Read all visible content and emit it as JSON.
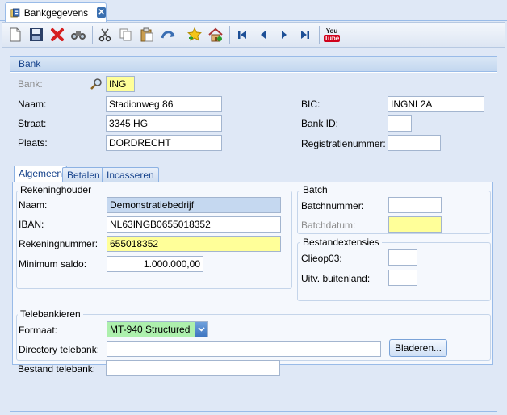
{
  "window": {
    "tab_title": "Bankgegevens",
    "colors": {
      "accent": "#15428b",
      "highlight": "#ffff99",
      "readonly": "#c5d8f0",
      "combo": "#adf0ad"
    }
  },
  "toolbar": {
    "icons": [
      "new-icon",
      "save-icon",
      "delete-icon",
      "find-icon",
      "cut-icon",
      "copy-icon",
      "paste-icon",
      "undo-icon",
      "favorite-icon",
      "home-icon",
      "first-record-icon",
      "previous-record-icon",
      "next-record-icon",
      "last-record-icon",
      "youtube-icon"
    ],
    "youtube_you": "You",
    "youtube_tube": "Tube"
  },
  "bank": {
    "header": "Bank",
    "labels": {
      "bank": "Bank:",
      "naam": "Naam:",
      "straat": "Straat:",
      "plaats": "Plaats:",
      "bic": "BIC:",
      "bank_id": "Bank ID:",
      "registratienummer": "Registratienummer:"
    },
    "values": {
      "bank": "ING",
      "naam": "Stadionweg 86",
      "straat": "3345 HG",
      "plaats": "DORDRECHT",
      "bic": "INGNL2A",
      "bank_id": "",
      "registratienummer": ""
    }
  },
  "tabs": [
    {
      "label": "Algemeen",
      "active": true
    },
    {
      "label": "Betalen",
      "active": false
    },
    {
      "label": "Incasseren",
      "active": false
    }
  ],
  "rekeninghouder": {
    "title": "Rekeninghouder",
    "labels": {
      "naam": "Naam:",
      "iban": "IBAN:",
      "rekeningnummer": "Rekeningnummer:",
      "minimum_saldo": "Minimum saldo:"
    },
    "values": {
      "naam": "Demonstratiebedrijf",
      "iban": "NL63INGB0655018352",
      "rekeningnummer": "655018352",
      "minimum_saldo": "1.000.000,00"
    }
  },
  "batch": {
    "title": "Batch",
    "labels": {
      "batchnummer": "Batchnummer:",
      "batchdatum": "Batchdatum:"
    },
    "values": {
      "batchnummer": "",
      "batchdatum": ""
    }
  },
  "bestandextensies": {
    "title": "Bestandextensies",
    "labels": {
      "clieop03": "Clieop03:",
      "uitv_buitenland": "Uitv. buitenland:"
    },
    "values": {
      "clieop03": "",
      "uitv_buitenland": ""
    }
  },
  "telebankieren": {
    "title": "Telebankieren",
    "labels": {
      "formaat": "Formaat:",
      "directory": "Directory telebank:",
      "bestand": "Bestand telebank:"
    },
    "values": {
      "formaat": "MT-940 Structured",
      "directory": "",
      "bestand": ""
    },
    "browse_label": "Bladeren..."
  }
}
